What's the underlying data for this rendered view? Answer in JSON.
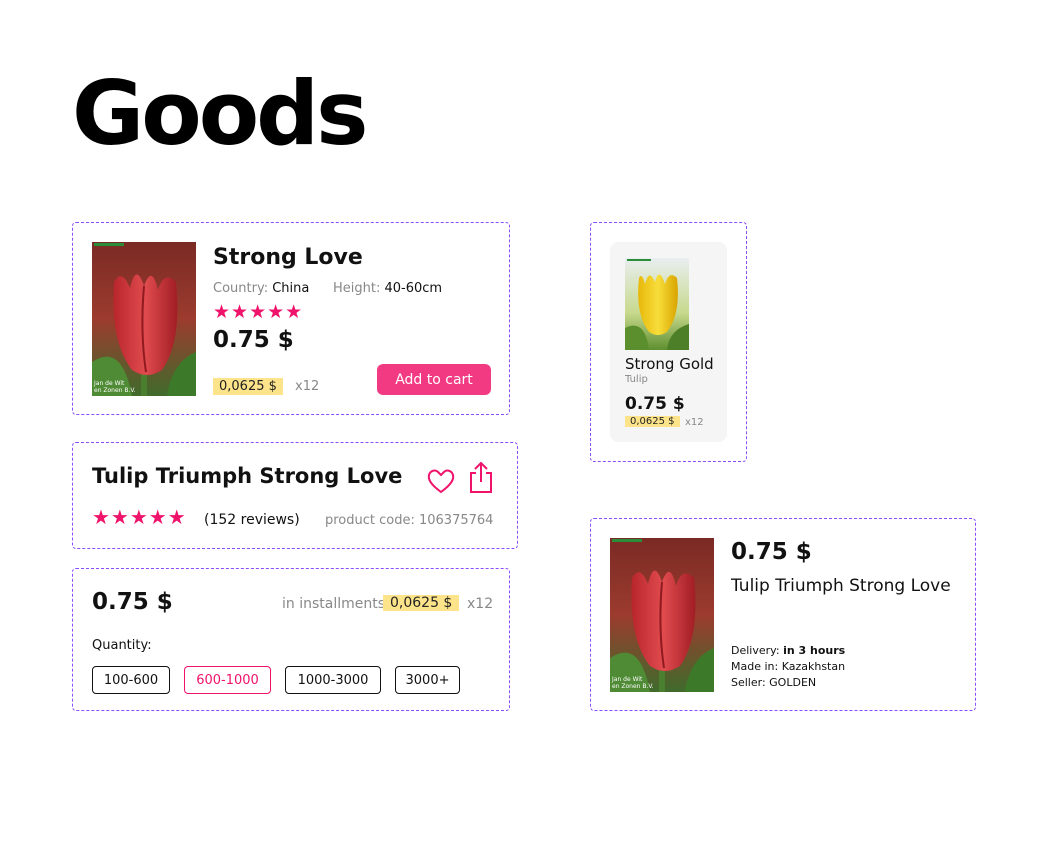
{
  "page": {
    "title": "Goods"
  },
  "card_compact": {
    "name": "Strong Love",
    "country_label": "Country:",
    "country_value": "China",
    "height_label": "Height:",
    "height_value": "40-60cm",
    "stars": "★★★★★",
    "price": "0.75 $",
    "installment": "0,0625 $",
    "multiplier": "x12",
    "add_to_cart": "Add to cart"
  },
  "product_header": {
    "title": "Tulip Triumph Strong Love",
    "stars": "★★★★★",
    "reviews": "(152 reviews)",
    "product_code": "product code: 106375764",
    "favorite_icon": "heart-icon",
    "share_icon": "share-icon"
  },
  "price_block": {
    "price": "0.75 $",
    "installments_label": "in installments",
    "installment": "0,0625 $",
    "multiplier": "x12",
    "quantity_label": "Quantity:",
    "options": [
      "100-600",
      "600-1000",
      "1000-3000",
      "3000+"
    ],
    "selected": "600-1000"
  },
  "card_tile": {
    "name": "Strong Gold",
    "type": "Tulip",
    "price": "0.75 $",
    "installment": "0,0625 $",
    "multiplier": "x12"
  },
  "card_row": {
    "price": "0.75 $",
    "title": "Tulip Triumph Strong Love",
    "delivery_label": "Delivery:",
    "delivery_value": "in 3 hours",
    "made_in": "Made in: Kazakhstan",
    "seller": "Seller: GOLDEN"
  },
  "colors": {
    "accent": "#f0136b",
    "button": "#f23a83",
    "installment_bg": "#fde38a",
    "frame_border": "#8a4dff"
  }
}
